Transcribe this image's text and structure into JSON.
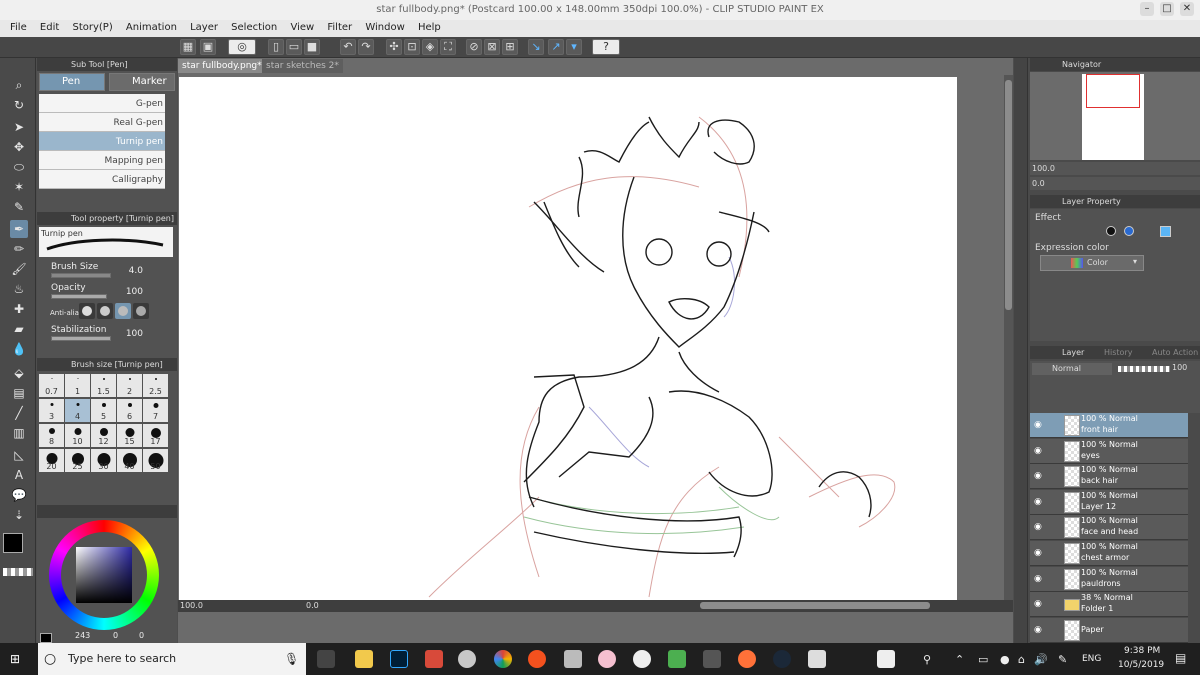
{
  "window": {
    "title": "star fullbody.png* (Postcard 100.00 x 148.00mm 350dpi 100.0%) - CLIP STUDIO PAINT EX",
    "controls": [
      "–",
      "□",
      "✕"
    ]
  },
  "menu": [
    "File",
    "Edit",
    "Story(P)",
    "Animation",
    "Layer",
    "Selection",
    "View",
    "Filter",
    "Window",
    "Help"
  ],
  "subtool": {
    "header": "Sub Tool [Pen]",
    "tabs": [
      "Pen",
      "Marker"
    ],
    "brushes": [
      "G-pen",
      "Real G-pen",
      "Turnip pen",
      "Mapping pen",
      "Calligraphy"
    ],
    "selected_brush": "Turnip pen"
  },
  "tool_property": {
    "header": "Tool property [Turnip pen]",
    "preview_label": "Turnip pen",
    "brush_size_label": "Brush Size",
    "brush_size_value": "4.0",
    "opacity_label": "Opacity",
    "opacity_value": "100",
    "antialias_label": "Anti-alia",
    "stabilization_label": "Stabilization",
    "stabilization_value": "100"
  },
  "brush_size_palette": {
    "header": "Brush size [Turnip pen]",
    "sizes": [
      "0.7",
      "1",
      "1.5",
      "2",
      "2.5",
      "3",
      "4",
      "5",
      "6",
      "7",
      "8",
      "10",
      "12",
      "15",
      "17",
      "20",
      "25",
      "30",
      "40",
      "50"
    ],
    "selected": "4"
  },
  "color": {
    "main": "#000000",
    "sub": "#ffffff",
    "hue_value": "243",
    "sat_value": "0",
    "val_value": "0"
  },
  "document_tabs": [
    "star fullbody.png*",
    "star sketches 2*"
  ],
  "canvas_status": {
    "zoom": "100.0",
    "rotation": "0.0"
  },
  "navigator": {
    "header": "Navigator",
    "zoom": "100.0",
    "rotation": "0.0"
  },
  "layer_property": {
    "header": "Layer Property",
    "effect_label": "Effect",
    "expression_color_label": "Expression color",
    "expression_color_value": "Color"
  },
  "layer_panel": {
    "tabs": [
      "Layer",
      "History",
      "Auto Action"
    ],
    "blend_mode": "Normal",
    "opacity": "100",
    "layers": [
      {
        "mode": "100 % Normal",
        "name": "front hair",
        "selected": true
      },
      {
        "mode": "100 % Normal",
        "name": "eyes",
        "selected": false
      },
      {
        "mode": "100 % Normal",
        "name": "back hair",
        "selected": false
      },
      {
        "mode": "100 % Normal",
        "name": "Layer 12",
        "selected": false
      },
      {
        "mode": "100 % Normal",
        "name": "face and head",
        "selected": false
      },
      {
        "mode": "100 % Normal",
        "name": "chest armor",
        "selected": false
      },
      {
        "mode": "100 % Normal",
        "name": "pauldrons",
        "selected": false
      },
      {
        "mode": "38 % Normal",
        "name": "Folder 1",
        "selected": false
      },
      {
        "mode": "",
        "name": "Paper",
        "selected": false
      }
    ]
  },
  "taskbar": {
    "search_placeholder": "Type here to search",
    "language": "ENG",
    "time": "9:38 PM",
    "date": "10/5/2019"
  },
  "colors": {
    "accent_selected": "#7e9db5",
    "panel_bg": "#525252"
  }
}
